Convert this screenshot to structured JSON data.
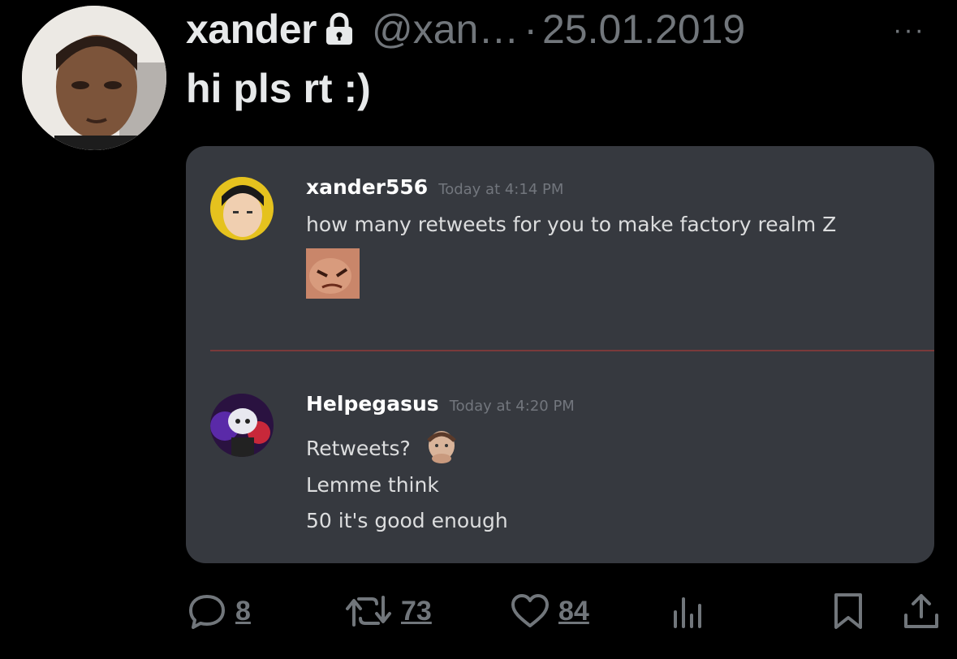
{
  "tweet": {
    "display_name": "xander",
    "handle": "@xan…",
    "separator": "·",
    "date": "25.01.2019",
    "text": "hi pls rt :)"
  },
  "discord": {
    "messages": [
      {
        "username": "xander556",
        "timestamp": "Today at 4:14 PM",
        "lines": [
          "how many retweets for you to make factory realm Z"
        ]
      },
      {
        "username": "Helpegasus",
        "timestamp": "Today at 4:20 PM",
        "lines": [
          "Retweets?",
          "Lemme think",
          "50 it's good enough"
        ]
      }
    ]
  },
  "actions": {
    "replies": "8",
    "retweets": "73",
    "likes": "84"
  },
  "icons": [
    "lock-icon",
    "more-icon",
    "reply-icon",
    "retweet-icon",
    "like-icon",
    "views-icon",
    "bookmark-icon",
    "share-icon"
  ],
  "colors": {
    "background": "#000000",
    "card": "#36393f",
    "muted": "#71767b",
    "divider": "#7a3a3a"
  }
}
